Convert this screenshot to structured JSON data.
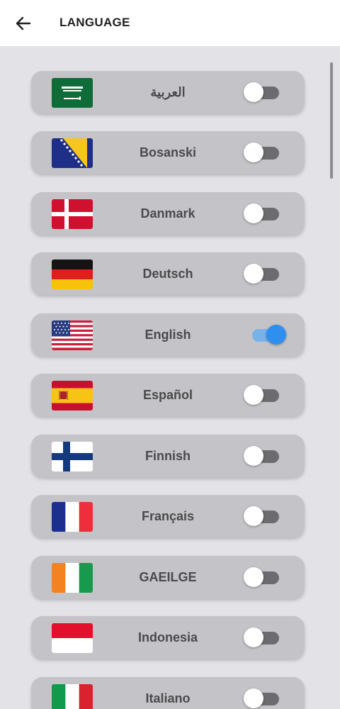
{
  "header": {
    "title": "LANGUAGE"
  },
  "languages": [
    {
      "label": "العربية",
      "flag": "saudi-arabia",
      "enabled": false
    },
    {
      "label": "Bosanski",
      "flag": "bosnia",
      "enabled": false
    },
    {
      "label": "Danmark",
      "flag": "denmark",
      "enabled": false
    },
    {
      "label": "Deutsch",
      "flag": "germany",
      "enabled": false
    },
    {
      "label": "English",
      "flag": "usa",
      "enabled": true
    },
    {
      "label": "Español",
      "flag": "spain",
      "enabled": false
    },
    {
      "label": "Finnish",
      "flag": "finland",
      "enabled": false
    },
    {
      "label": "Français",
      "flag": "france",
      "enabled": false
    },
    {
      "label": "GAEILGE",
      "flag": "ireland",
      "enabled": false
    },
    {
      "label": "Indonesia",
      "flag": "indonesia",
      "enabled": false
    },
    {
      "label": "Italiano",
      "flag": "italy",
      "enabled": false
    }
  ],
  "colors": {
    "accent": "#2f8fef",
    "card": "#c4c3c7",
    "background": "#e3e2e6"
  }
}
